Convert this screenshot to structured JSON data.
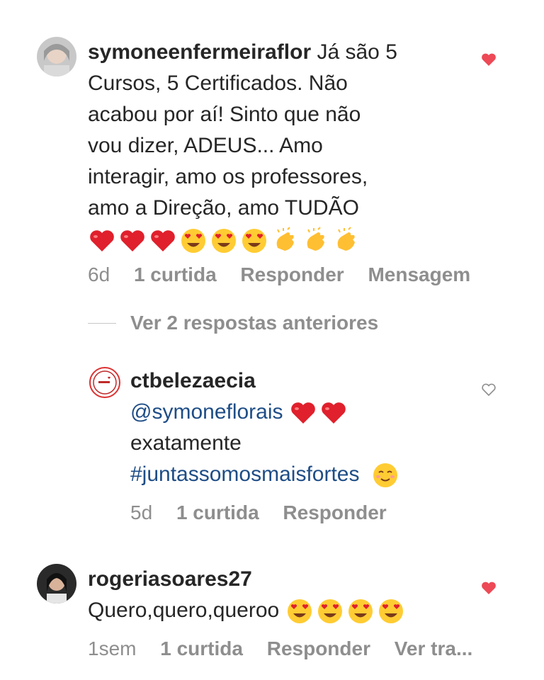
{
  "comments": [
    {
      "username": "symoneenfermeiraflor",
      "lines": [
        "Já são 5",
        "Cursos, 5 Certificados. Não",
        "acabou por aí! Sinto que não",
        "vou dizer, ADEUS... Amo",
        "interagir, amo os professores,",
        "amo a  Direção, amo  TUDÃO"
      ],
      "emojis": [
        "red-heart",
        "red-heart",
        "red-heart",
        "heart-eyes",
        "heart-eyes",
        "heart-eyes",
        "clapping-hands",
        "clapping-hands",
        "clapping-hands"
      ],
      "time": "6d",
      "likes": "1 curtida",
      "reply": "Responder",
      "message": "Mensagem",
      "liked": true
    },
    {
      "view_replies": "Ver 2 respostas anteriores"
    },
    {
      "username": "ctbelezaecia",
      "mention": "@symoneflorais",
      "line2": "exatamente",
      "hashtag": "#juntassomosmaisfortes",
      "time": "5d",
      "likes": "1 curtida",
      "reply": "Responder",
      "liked": false
    },
    {
      "username": "rogeriasoares27",
      "text": "Quero,quero,queroo",
      "time": "1sem",
      "likes": "1 curtida",
      "reply": "Responder",
      "more": "Ver tra...",
      "liked": true
    }
  ],
  "colors": {
    "heart_red": "#ed4956",
    "text": "#262626",
    "meta_grey": "#8e8e8e",
    "link_blue": "#1e4d86"
  }
}
